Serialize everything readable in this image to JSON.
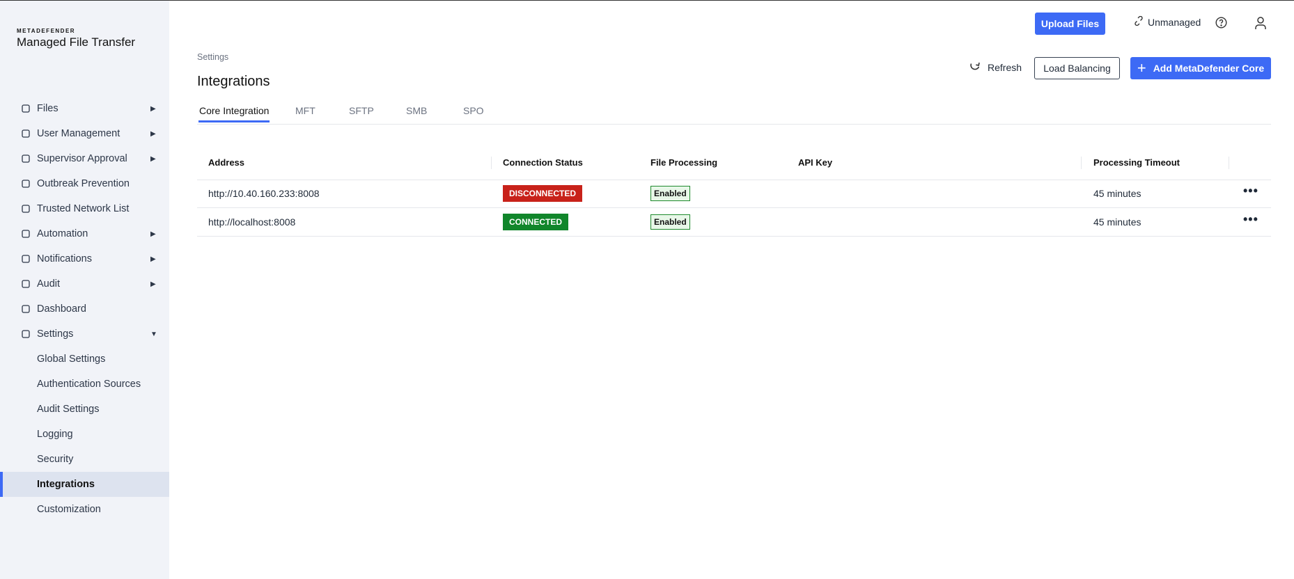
{
  "brand": {
    "small": "METADEFENDER",
    "big": "Managed File Transfer"
  },
  "sidebar": {
    "items": [
      {
        "label": "Files",
        "icon": "files-icon",
        "arrow": "▶"
      },
      {
        "label": "User Management",
        "icon": "users-icon",
        "arrow": "▶"
      },
      {
        "label": "Supervisor Approval",
        "icon": "approval-icon",
        "arrow": "▶"
      },
      {
        "label": "Outbreak Prevention",
        "icon": "shield-icon",
        "arrow": ""
      },
      {
        "label": "Trusted Network List",
        "icon": "globe-icon",
        "arrow": ""
      },
      {
        "label": "Automation",
        "icon": "automation-icon",
        "arrow": "▶"
      },
      {
        "label": "Notifications",
        "icon": "bell-icon",
        "arrow": "▶"
      },
      {
        "label": "Audit",
        "icon": "audit-icon",
        "arrow": "▶"
      },
      {
        "label": "Dashboard",
        "icon": "gauge-icon",
        "arrow": ""
      },
      {
        "label": "Settings",
        "icon": "gear-icon",
        "arrow": "▼"
      },
      {
        "label": "Global Settings"
      },
      {
        "label": "Authentication Sources"
      },
      {
        "label": "Audit Settings"
      },
      {
        "label": "Logging"
      },
      {
        "label": "Security"
      },
      {
        "label": "Integrations",
        "active": true
      },
      {
        "label": "Customization"
      }
    ]
  },
  "topbar": {
    "upload": "Upload Files",
    "unmanaged": "Unmanaged"
  },
  "breadcrumb": "Settings",
  "title": "Integrations",
  "actions": {
    "refresh": "Refresh",
    "load_balancing": "Load Balancing",
    "add_core": "Add MetaDefender Core"
  },
  "tabs": [
    "Core Integration",
    "MFT",
    "SFTP",
    "SMB",
    "SPO"
  ],
  "table": {
    "headers": [
      "Address",
      "Connection Status",
      "File Processing",
      "API Key",
      "Processing Timeout"
    ],
    "rows": [
      {
        "address": "http://10.40.160.233:8008",
        "status": "DISCONNECTED",
        "status_color": "#c8221a",
        "processing": "Enabled",
        "api_key": "",
        "timeout": "45 minutes"
      },
      {
        "address": "http://localhost:8008",
        "status": "CONNECTED",
        "status_color": "#11862b",
        "processing": "Enabled",
        "api_key": "",
        "timeout": "45 minutes"
      }
    ]
  },
  "colors": {
    "accent": "#3d6af5"
  }
}
